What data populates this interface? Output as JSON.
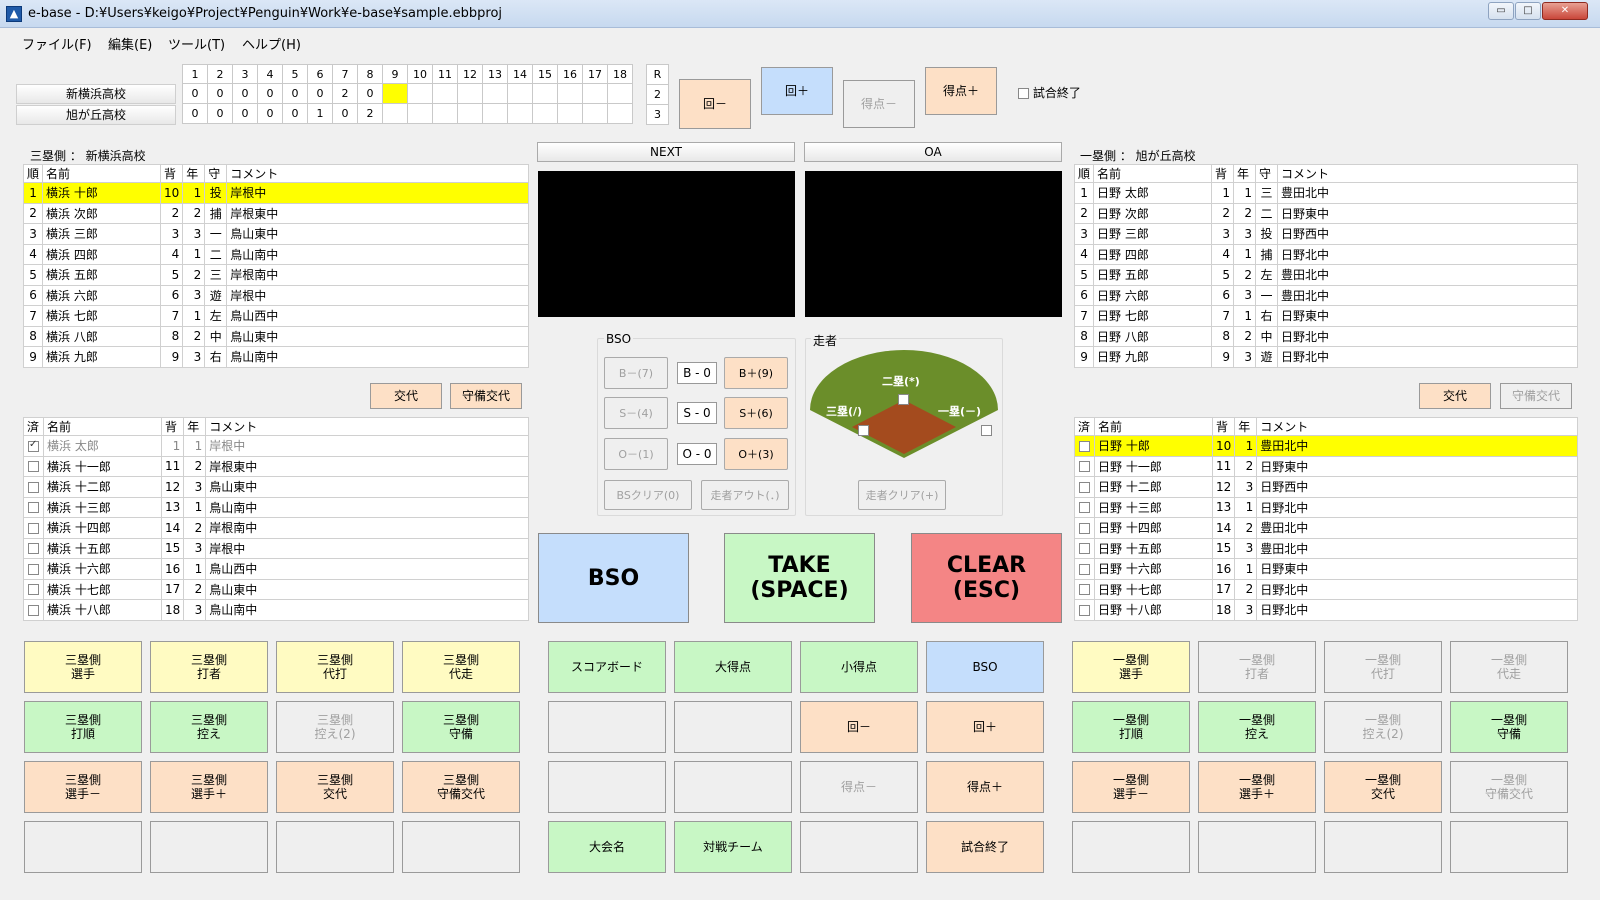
{
  "window": {
    "title": "e-base - D:¥Users¥keigo¥Project¥Penguin¥Work¥e-base¥sample.ebbproj",
    "app_icon": "▲",
    "min": "▭",
    "max": "□",
    "close": "✕"
  },
  "menu": [
    "ファイル(F)",
    "編集(E)",
    "ツール(T)",
    "ヘルプ(H)"
  ],
  "scoreboard": {
    "innings": [
      "1",
      "2",
      "3",
      "4",
      "5",
      "6",
      "7",
      "8",
      "9",
      "10",
      "11",
      "12",
      "13",
      "14",
      "15",
      "16",
      "17",
      "18"
    ],
    "runs_header": "R",
    "teams": [
      {
        "name": "新横浜高校",
        "scores": [
          "0",
          "0",
          "0",
          "0",
          "0",
          "0",
          "2",
          "0",
          "",
          "",
          "",
          "",
          "",
          "",
          "",
          "",
          "",
          ""
        ],
        "total": "2"
      },
      {
        "name": "旭が丘高校",
        "scores": [
          "0",
          "0",
          "0",
          "0",
          "0",
          "1",
          "0",
          "2",
          "",
          "",
          "",
          "",
          "",
          "",
          "",
          "",
          "",
          ""
        ],
        "total": "3"
      }
    ],
    "current_inning_index": 8
  },
  "top_buttons": {
    "inning_minus": "回－",
    "inning_plus": "回＋",
    "score_minus": "得点－",
    "score_plus": "得点＋",
    "game_end": "試合終了"
  },
  "left": {
    "title": "三塁側 ： 新横浜高校",
    "headers": [
      "順",
      "名前",
      "背",
      "年",
      "守",
      "コメント"
    ],
    "lineup": [
      [
        "1",
        "横浜 十郎",
        "10",
        "1",
        "投",
        "岸根中"
      ],
      [
        "2",
        "横浜 次郎",
        "2",
        "2",
        "捕",
        "岸根東中"
      ],
      [
        "3",
        "横浜 三郎",
        "3",
        "3",
        "一",
        "鳥山東中"
      ],
      [
        "4",
        "横浜 四郎",
        "4",
        "1",
        "二",
        "鳥山南中"
      ],
      [
        "5",
        "横浜 五郎",
        "5",
        "2",
        "三",
        "岸根南中"
      ],
      [
        "6",
        "横浜 六郎",
        "6",
        "3",
        "遊",
        "岸根中"
      ],
      [
        "7",
        "横浜 七郎",
        "7",
        "1",
        "左",
        "鳥山西中"
      ],
      [
        "8",
        "横浜 八郎",
        "8",
        "2",
        "中",
        "鳥山東中"
      ],
      [
        "9",
        "横浜 九郎",
        "9",
        "3",
        "右",
        "鳥山南中"
      ]
    ],
    "btn_sub": "交代",
    "btn_def_sub": "守備交代",
    "bench_headers": [
      "済",
      "名前",
      "背",
      "年",
      "コメント"
    ],
    "bench": [
      [
        true,
        "横浜 太郎",
        "1",
        "1",
        "岸根中"
      ],
      [
        false,
        "横浜 十一郎",
        "11",
        "2",
        "岸根東中"
      ],
      [
        false,
        "横浜 十二郎",
        "12",
        "3",
        "鳥山東中"
      ],
      [
        false,
        "横浜 十三郎",
        "13",
        "1",
        "鳥山南中"
      ],
      [
        false,
        "横浜 十四郎",
        "14",
        "2",
        "岸根南中"
      ],
      [
        false,
        "横浜 十五郎",
        "15",
        "3",
        "岸根中"
      ],
      [
        false,
        "横浜 十六郎",
        "16",
        "1",
        "鳥山西中"
      ],
      [
        false,
        "横浜 十七郎",
        "17",
        "2",
        "鳥山東中"
      ],
      [
        false,
        "横浜 十八郎",
        "18",
        "3",
        "鳥山南中"
      ]
    ]
  },
  "right": {
    "title": "一塁側 ： 旭が丘高校",
    "headers": [
      "順",
      "名前",
      "背",
      "年",
      "守",
      "コメント"
    ],
    "lineup": [
      [
        "1",
        "日野 太郎",
        "1",
        "1",
        "三",
        "豊田北中"
      ],
      [
        "2",
        "日野 次郎",
        "2",
        "2",
        "二",
        "日野東中"
      ],
      [
        "3",
        "日野 三郎",
        "3",
        "3",
        "投",
        "日野西中"
      ],
      [
        "4",
        "日野 四郎",
        "4",
        "1",
        "捕",
        "日野北中"
      ],
      [
        "5",
        "日野 五郎",
        "5",
        "2",
        "左",
        "豊田北中"
      ],
      [
        "6",
        "日野 六郎",
        "6",
        "3",
        "一",
        "豊田北中"
      ],
      [
        "7",
        "日野 七郎",
        "7",
        "1",
        "右",
        "日野東中"
      ],
      [
        "8",
        "日野 八郎",
        "8",
        "2",
        "中",
        "日野北中"
      ],
      [
        "9",
        "日野 九郎",
        "9",
        "3",
        "遊",
        "日野北中"
      ]
    ],
    "btn_sub": "交代",
    "btn_def_sub": "守備交代",
    "bench_headers": [
      "済",
      "名前",
      "背",
      "年",
      "コメント"
    ],
    "bench": [
      [
        false,
        "日野 十郎",
        "10",
        "1",
        "豊田北中"
      ],
      [
        false,
        "日野 十一郎",
        "11",
        "2",
        "日野東中"
      ],
      [
        false,
        "日野 十二郎",
        "12",
        "3",
        "日野西中"
      ],
      [
        false,
        "日野 十三郎",
        "13",
        "1",
        "日野北中"
      ],
      [
        false,
        "日野 十四郎",
        "14",
        "2",
        "豊田北中"
      ],
      [
        false,
        "日野 十五郎",
        "15",
        "3",
        "豊田北中"
      ],
      [
        false,
        "日野 十六郎",
        "16",
        "1",
        "日野東中"
      ],
      [
        false,
        "日野 十七郎",
        "17",
        "2",
        "日野北中"
      ],
      [
        false,
        "日野 十八郎",
        "18",
        "3",
        "日野北中"
      ]
    ]
  },
  "preview": {
    "next": "NEXT",
    "oa": "OA"
  },
  "bso": {
    "label": "BSO",
    "b_minus": "B－(7)",
    "b_val": "B - 0",
    "b_plus": "B＋(9)",
    "s_minus": "S－(4)",
    "s_val": "S - 0",
    "s_plus": "S＋(6)",
    "o_minus": "O－(1)",
    "o_val": "O - 0",
    "o_plus": "O＋(3)",
    "clear": "BSクリア(0)",
    "runner_out": "走者アウト(．)"
  },
  "runner": {
    "label": "走者",
    "second": "二塁(*)",
    "third": "三塁(/)",
    "first": "一塁(－)",
    "clear": "走者クリア(+)"
  },
  "main": {
    "bso": "BSO",
    "take1": "TAKE",
    "take2": "(SPACE)",
    "clear1": "CLEAR",
    "clear2": "(ESC)"
  },
  "grid_left": [
    [
      "三塁側",
      "選手"
    ],
    [
      "三塁側",
      "打者"
    ],
    [
      "三塁側",
      "代打"
    ],
    [
      "三塁側",
      "代走"
    ],
    [
      "三塁側",
      "打順"
    ],
    [
      "三塁側",
      "控え"
    ],
    [
      "三塁側",
      "控え(2)"
    ],
    [
      "三塁側",
      "守備"
    ],
    [
      "三塁側",
      "選手－"
    ],
    [
      "三塁側",
      "選手＋"
    ],
    [
      "三塁側",
      "交代"
    ],
    [
      "三塁側",
      "守備交代"
    ],
    [
      ""
    ],
    [
      ""
    ],
    [
      ""
    ],
    [
      ""
    ]
  ],
  "grid_center": [
    [
      "スコアボード"
    ],
    [
      "大得点"
    ],
    [
      "小得点"
    ],
    [
      "BSO"
    ],
    [
      ""
    ],
    [
      ""
    ],
    [
      "回－"
    ],
    [
      "回＋"
    ],
    [
      ""
    ],
    [
      ""
    ],
    [
      "得点－"
    ],
    [
      "得点＋"
    ],
    [
      "大会名"
    ],
    [
      "対戦チーム"
    ],
    [
      ""
    ],
    [
      "試合終了"
    ]
  ],
  "grid_right": [
    [
      "一塁側",
      "選手"
    ],
    [
      "一塁側",
      "打者"
    ],
    [
      "一塁側",
      "代打"
    ],
    [
      "一塁側",
      "代走"
    ],
    [
      "一塁側",
      "打順"
    ],
    [
      "一塁側",
      "控え"
    ],
    [
      "一塁側",
      "控え(2)"
    ],
    [
      "一塁側",
      "守備"
    ],
    [
      "一塁側",
      "選手－"
    ],
    [
      "一塁側",
      "選手＋"
    ],
    [
      "一塁側",
      "交代"
    ],
    [
      "一塁側",
      "守備交代"
    ],
    [
      ""
    ],
    [
      ""
    ],
    [
      ""
    ],
    [
      ""
    ]
  ]
}
